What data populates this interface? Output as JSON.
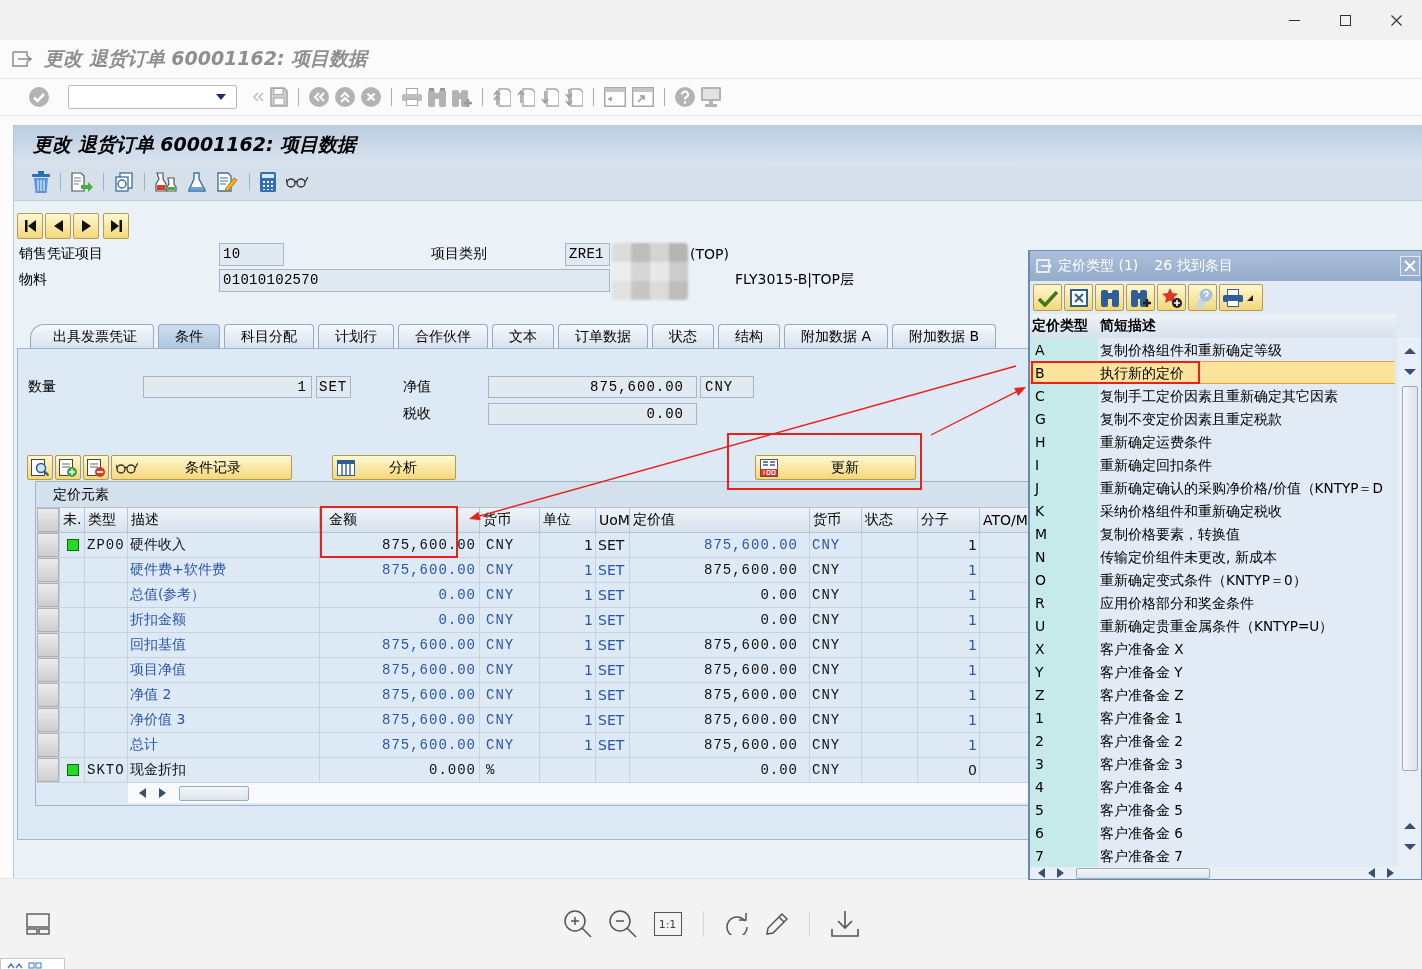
{
  "viewer": {
    "actual_size_label": "1:1"
  },
  "sap": {
    "title": "更改 退货订单 60001162: 项目数据",
    "screen_title": "更改 退货订单 60001162: 项目数据",
    "header_fields": [
      {
        "label": "销售凭证项目",
        "value": "10"
      },
      {
        "label": "项目类别",
        "value": "ZRE1",
        "description": "(TOP)"
      },
      {
        "label": "物料",
        "value": "01010102570",
        "description": "FLY3015-B|TOP层"
      }
    ],
    "tabs": [
      {
        "label": "出具发票凭证",
        "selected": false
      },
      {
        "label": "条件",
        "selected": true
      },
      {
        "label": "科目分配",
        "selected": false
      },
      {
        "label": "计划行",
        "selected": false
      },
      {
        "label": "合作伙伴",
        "selected": false
      },
      {
        "label": "文本",
        "selected": false
      },
      {
        "label": "订单数据",
        "selected": false
      },
      {
        "label": "状态",
        "selected": false
      },
      {
        "label": "结构",
        "selected": false
      },
      {
        "label": "附加数据 A",
        "selected": false
      },
      {
        "label": "附加数据 B",
        "selected": false
      }
    ],
    "conditions": {
      "quantity": {
        "label": "数量",
        "value": "1",
        "unit": "SET"
      },
      "net_value": {
        "label": "净值",
        "value": "875,600.00",
        "currency": "CNY"
      },
      "tax": {
        "label": "税收",
        "value": "0.00"
      },
      "buttons": [
        {
          "label": "条件记录",
          "marked": false
        },
        {
          "label": "分析",
          "marked": false
        },
        {
          "label": "更新",
          "marked": true
        }
      ],
      "table": {
        "title": "定价元素",
        "columns": [
          {
            "label": "未.",
            "marked": false
          },
          {
            "label": "类型",
            "marked": false
          },
          {
            "label": "描述",
            "marked": false
          },
          {
            "label": "金额",
            "marked": true
          },
          {
            "label": "货币",
            "marked": false
          },
          {
            "label": "单位",
            "marked": false
          },
          {
            "label": "UoM",
            "marked": false
          },
          {
            "label": "定价值",
            "marked": false
          },
          {
            "label": "货币",
            "marked": false
          },
          {
            "label": "状态",
            "marked": false
          },
          {
            "label": "分子",
            "marked": false
          },
          {
            "label": "ATO/M",
            "marked": false
          }
        ],
        "rows": [
          {
            "kind": "condition",
            "type": "ZP00",
            "description": "硬件收入",
            "amount": "875,600.00",
            "currency": "CNY",
            "unit": "1",
            "uom": "SET",
            "value": "875,600.00",
            "value_currency": "CNY",
            "color": "#2b56a6",
            "numerator": "1"
          },
          {
            "kind": "subtotal",
            "description": "硬件费+软件费",
            "amount": "875,600.00",
            "currency": "CNY",
            "unit": "1",
            "uom": "SET",
            "value": "875,600.00",
            "value_currency": "CNY",
            "color": "#111111",
            "numerator": "1"
          },
          {
            "kind": "subtotal",
            "description": "总值(参考）",
            "amount": "0.00",
            "currency": "CNY",
            "unit": "1",
            "uom": "SET",
            "value": "0.00",
            "value_currency": "CNY",
            "color": "#111111",
            "numerator": "1"
          },
          {
            "kind": "subtotal",
            "description": "折扣金额",
            "amount": "0.00",
            "currency": "CNY",
            "unit": "1",
            "uom": "SET",
            "value": "0.00",
            "value_currency": "CNY",
            "color": "#111111",
            "numerator": "1"
          },
          {
            "kind": "subtotal",
            "description": "回扣基值",
            "amount": "875,600.00",
            "currency": "CNY",
            "unit": "1",
            "uom": "SET",
            "value": "875,600.00",
            "value_currency": "CNY",
            "color": "#111111",
            "numerator": "1"
          },
          {
            "kind": "subtotal",
            "description": "项目净值",
            "amount": "875,600.00",
            "currency": "CNY",
            "unit": "1",
            "uom": "SET",
            "value": "875,600.00",
            "value_currency": "CNY",
            "color": "#111111",
            "numerator": "1"
          },
          {
            "kind": "subtotal",
            "description": "净值 2",
            "amount": "875,600.00",
            "currency": "CNY",
            "unit": "1",
            "uom": "SET",
            "value": "875,600.00",
            "value_currency": "CNY",
            "color": "#111111",
            "numerator": "1"
          },
          {
            "kind": "subtotal",
            "description": "净价值 3",
            "amount": "875,600.00",
            "currency": "CNY",
            "unit": "1",
            "uom": "SET",
            "value": "875,600.00",
            "value_currency": "CNY",
            "color": "#111111",
            "numerator": "1"
          },
          {
            "kind": "subtotal",
            "description": "总计",
            "amount": "875,600.00",
            "currency": "CNY",
            "unit": "1",
            "uom": "SET",
            "value": "875,600.00",
            "value_currency": "CNY",
            "color": "#111111",
            "numerator": "1"
          },
          {
            "kind": "condition",
            "type": "SKTO",
            "description": "现金折扣",
            "amount": "0.000",
            "currency": "%",
            "value": "0.00",
            "value_currency": "CNY",
            "color": "#111111",
            "numerator": "0"
          }
        ]
      }
    }
  },
  "popup": {
    "title": "定价类型 (1)",
    "count": "26 找到条目",
    "columns": [
      "定价类型",
      "简短描述"
    ],
    "rows": [
      {
        "code": "A",
        "text": "复制价格组件和重新确定等级",
        "selected": false,
        "marked": false
      },
      {
        "code": "B",
        "text": "执行新的定价",
        "selected": true,
        "marked": true
      },
      {
        "code": "C",
        "text": "复制手工定价因素且重新确定其它因素",
        "selected": false,
        "marked": false
      },
      {
        "code": "G",
        "text": "复制不变定价因素且重定税款",
        "selected": false,
        "marked": false
      },
      {
        "code": "H",
        "text": "重新确定运费条件",
        "selected": false,
        "marked": false
      },
      {
        "code": "I",
        "text": "重新确定回扣条件",
        "selected": false,
        "marked": false
      },
      {
        "code": "J",
        "text": "重新确定确认的采购净价格/价值（KNTYP＝D",
        "selected": false,
        "marked": false
      },
      {
        "code": "K",
        "text": "采纳价格组件和重新确定税收",
        "selected": false,
        "marked": false
      },
      {
        "code": "M",
        "text": "复制价格要素，转换值",
        "selected": false,
        "marked": false
      },
      {
        "code": "N",
        "text": "传输定价组件未更改, 新成本",
        "selected": false,
        "marked": false
      },
      {
        "code": "O",
        "text": "重新确定变式条件（KNTYP＝0）",
        "selected": false,
        "marked": false
      },
      {
        "code": "R",
        "text": "应用价格部分和奖金条件",
        "selected": false,
        "marked": false
      },
      {
        "code": "U",
        "text": "重新确定贵重金属条件（KNTYP=U）",
        "selected": false,
        "marked": false
      },
      {
        "code": "X",
        "text": "客户准备金 X",
        "selected": false,
        "marked": false
      },
      {
        "code": "Y",
        "text": "客户准备金 Y",
        "selected": false,
        "marked": false
      },
      {
        "code": "Z",
        "text": "客户准备金 Z",
        "selected": false,
        "marked": false
      },
      {
        "code": "1",
        "text": "客户准备金 1",
        "selected": false,
        "marked": false
      },
      {
        "code": "2",
        "text": "客户准备金 2",
        "selected": false,
        "marked": false
      },
      {
        "code": "3",
        "text": "客户准备金 3",
        "selected": false,
        "marked": false
      },
      {
        "code": "4",
        "text": "客户准备金 4",
        "selected": false,
        "marked": false
      },
      {
        "code": "5",
        "text": "客户准备金 5",
        "selected": false,
        "marked": false
      },
      {
        "code": "6",
        "text": "客户准备金 6",
        "selected": false,
        "marked": false
      },
      {
        "code": "7",
        "text": "客户准备金 7",
        "selected": false,
        "marked": false
      }
    ]
  }
}
